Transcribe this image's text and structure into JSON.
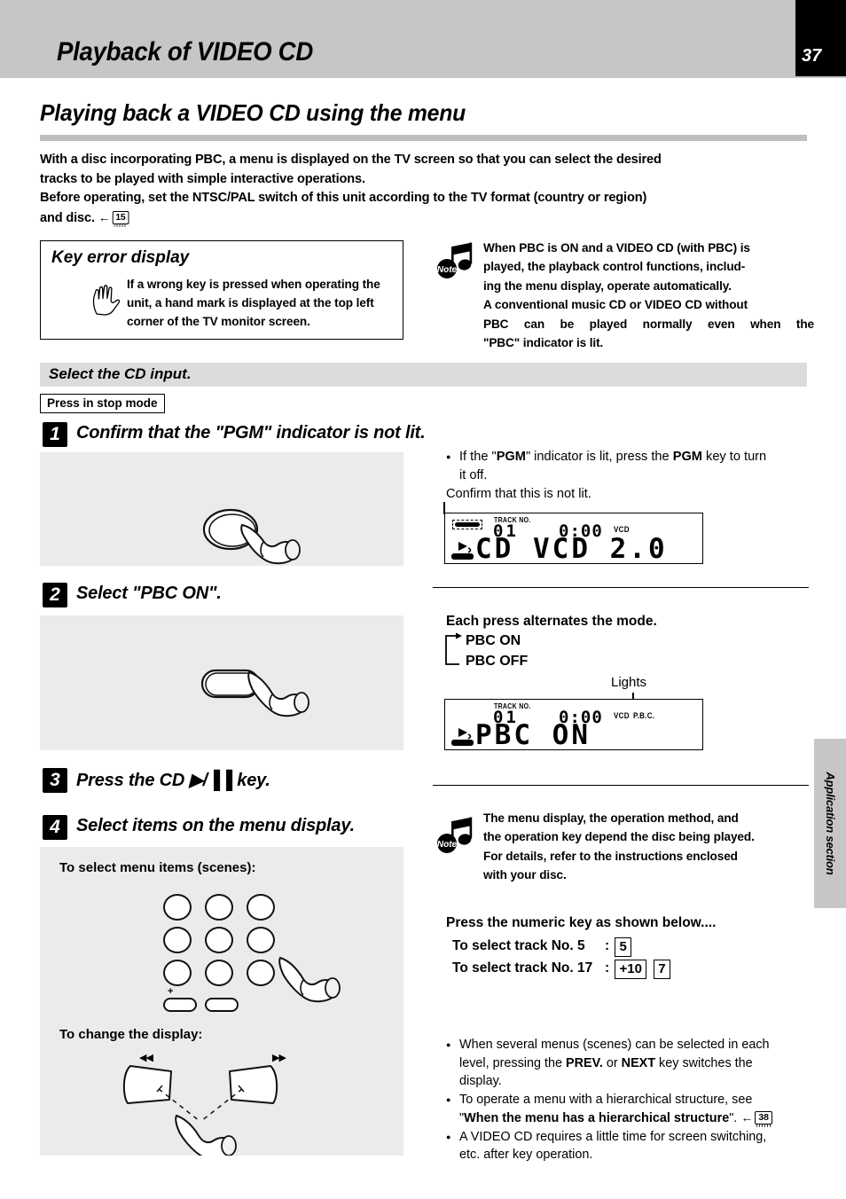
{
  "header": {
    "title": "Playback of VIDEO CD",
    "page_number": "37"
  },
  "section": {
    "title": "Playing back a VIDEO CD using the menu",
    "intro_line1": "With a disc incorporating PBC, a menu is displayed on the TV screen so that you can select the desired",
    "intro_line2": "tracks to be played with simple interactive operations.",
    "intro_line3": "Before operating, set the NTSC/PAL switch of this unit according to the TV format (country or region)",
    "intro_line4_prefix": "and disc.",
    "intro_arrow": "←",
    "intro_pageref": "15"
  },
  "key_error_box": {
    "title": "Key error display",
    "text": "If a wrong key is pressed when operating the unit, a hand mark is displayed at the top left corner of the TV monitor screen.",
    "icon": "hand-icon"
  },
  "note_top": {
    "badge": "Note",
    "line1": "When PBC is ON and a VIDEO CD (with PBC) is",
    "line2": "played, the playback control functions, includ-",
    "line3": "ing the menu display, operate automatically.",
    "line4": "A conventional music CD or VIDEO CD without",
    "line5": "PBC can be played normally even when the",
    "line6": "\"PBC\" indicator is lit."
  },
  "band": {
    "label": "Select the CD input."
  },
  "stop_mode_label": "Press in stop mode",
  "steps": [
    {
      "num": "1",
      "text": "Confirm that the \"PGM\" indicator is not lit."
    },
    {
      "num": "2",
      "text": "Select \"PBC ON\"."
    },
    {
      "num": "3",
      "text": "Press the CD ▶/▐▐ key."
    },
    {
      "num": "4",
      "text": "Select items on the menu display."
    }
  ],
  "step1_notes": {
    "bullet1_a": "If the \"",
    "bullet1_pgm1": "PGM",
    "bullet1_b": "\" indicator is lit, press the ",
    "bullet1_pgm2": "PGM",
    "bullet1_c": " key to turn",
    "bullet1_line2": "it off.",
    "line3": "Confirm that this is not lit."
  },
  "lcd1": {
    "track_label": "TRACK NO.",
    "track_value": "01",
    "time_value": "0:00",
    "indicator_vcd": "VCD",
    "main_text": "CD   VCD 2.0"
  },
  "step2_notes": {
    "title": "Each press alternates the mode.",
    "option1": "PBC ON",
    "option2": "PBC OFF",
    "lights_label": "Lights"
  },
  "lcd2": {
    "track_label": "TRACK NO.",
    "track_value": "01",
    "time_value": "0:00",
    "indicator_vcd": "VCD",
    "indicator_pbc": "P.B.C.",
    "main_text": "PBC ON"
  },
  "step4_panel": {
    "subtitle1": "To select menu items (scenes):",
    "subtitle2": "To change the display:",
    "plus_label": "+",
    "prev_label": "◀◀",
    "next_label": "▶▶"
  },
  "note_bottom": {
    "badge": "Note",
    "line1": "The menu display, the operation method, and",
    "line2": "the operation key depend the disc being played.",
    "line3": "For details, refer to the instructions enclosed",
    "line4": "with your disc."
  },
  "numeric": {
    "title": "Press the numeric key as shown below....",
    "row1_label": "To select track No. 5",
    "row1_colon": ":",
    "row1_key": "5",
    "row2_label": "To select track No. 17",
    "row2_colon": ":",
    "row2_key1": "+10",
    "row2_key2": "7"
  },
  "bottom_notes": {
    "b1_a": "When several menus (scenes) can be selected in each",
    "b1_b1": "level, pressing the ",
    "b1_prev": "PREV.",
    "b1_b2": " or ",
    "b1_next": "NEXT",
    "b1_b3": " key switches the",
    "b1_c": "display.",
    "b2_a": "To operate a menu with a hierarchical structure, see",
    "b2_quote_open": "\"",
    "b2_bold": "When the menu has a hierarchical structure",
    "b2_quote_close": "\".",
    "b2_arrow": "←",
    "b2_pageref": "38",
    "b3_a": "A VIDEO CD requires a little time for screen switching,",
    "b3_b": "etc. after key operation."
  },
  "side_tab": {
    "label": "Application section"
  },
  "colors": {
    "header_band": "#c6c6c6",
    "page_tab": "#000000",
    "section_rule": "#bfbfbf",
    "band": "#dcdcdc",
    "panel": "#ebebeb",
    "side_tab": "#c6c6c6"
  }
}
